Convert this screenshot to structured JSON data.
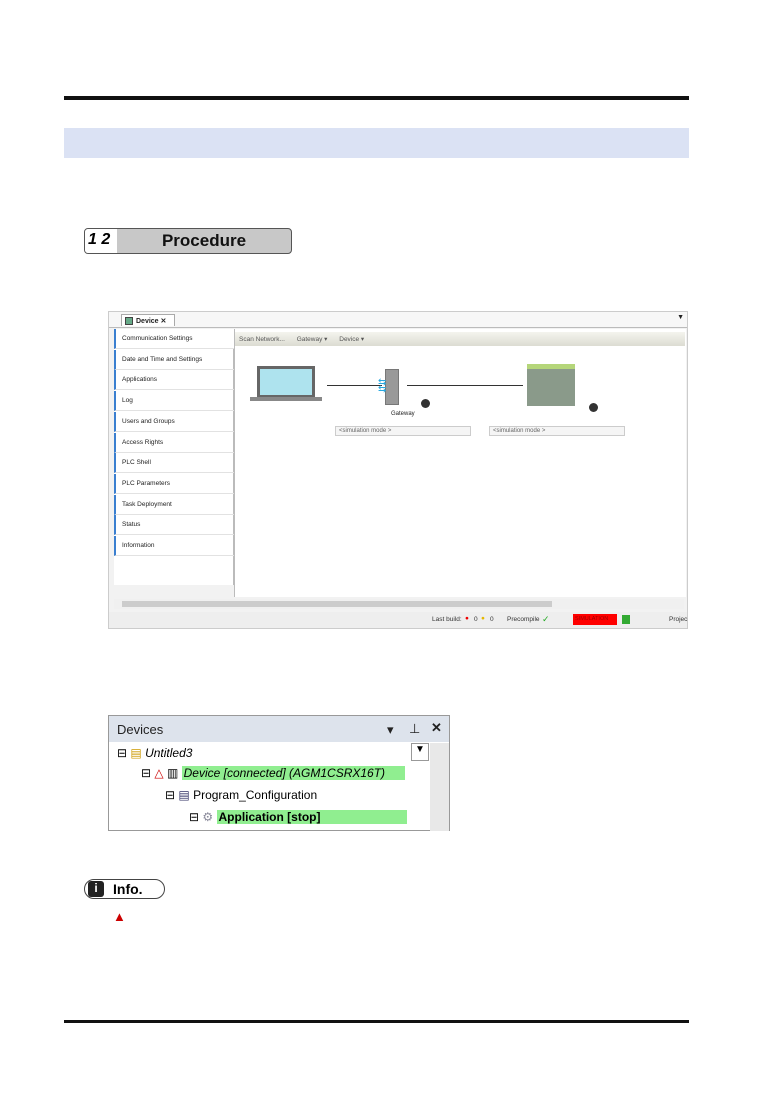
{
  "procedure": {
    "number": "1 2",
    "label": "Procedure"
  },
  "device_editor": {
    "tab_label": "Device",
    "tab_close": "✕",
    "sidebar": [
      "Communication Settings",
      "Date and Time and Settings",
      "Applications",
      "Log",
      "Users and Groups",
      "Access Rights",
      "PLC Shell",
      "PLC Parameters",
      "Task Deployment",
      "Status",
      "Information"
    ],
    "toolbar": {
      "scan": "Scan Network...",
      "gateway": "Gateway ▾",
      "device": "Device ▾"
    },
    "gateway_label": "Gateway",
    "gateway_select": "<simulation mode >",
    "device_select": "<simulation mode >",
    "status": {
      "last_build": "Last build:",
      "errors": "0",
      "warnings": "0",
      "precompile": "Precompile",
      "simulation": "SIMULATION",
      "project": "Projec"
    },
    "colors": {
      "simulation": "#ff0000",
      "accent": "#3a7fd0"
    }
  },
  "devices_panel": {
    "title": "Devices",
    "tree": [
      "Untitled3",
      "Device [connected] (AGM1CSRX16T)",
      "Program_Configuration",
      "Application [stop]"
    ],
    "highlight": "#90ee90"
  },
  "info": {
    "label": "Info."
  }
}
